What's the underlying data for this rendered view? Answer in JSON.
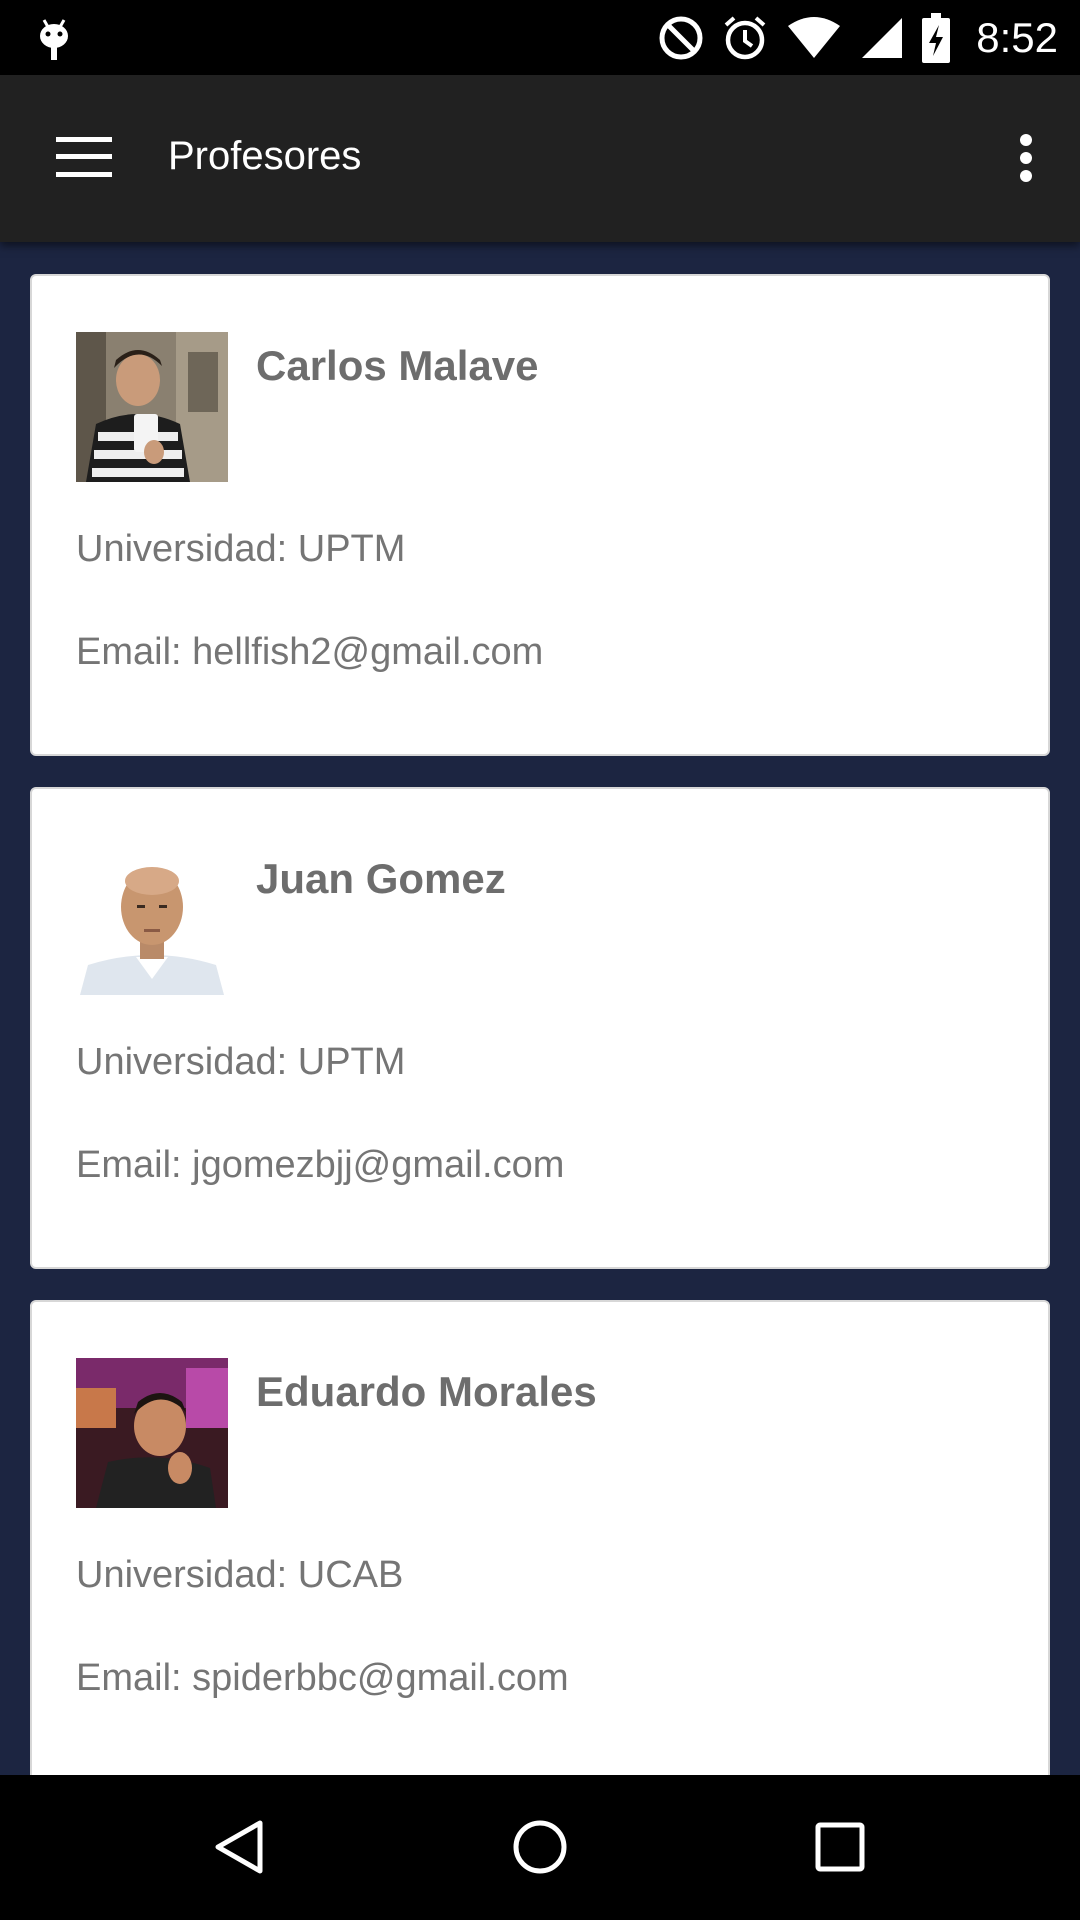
{
  "status_bar": {
    "time": "8:52",
    "icons": [
      "android-debug-icon",
      "do-not-disturb-icon",
      "alarm-icon",
      "wifi-icon",
      "cell-signal-icon",
      "battery-charging-icon"
    ]
  },
  "app_bar": {
    "title": "Profesores",
    "menu_icon": "hamburger-menu-icon",
    "overflow_icon": "more-vert-icon",
    "background": "#212121"
  },
  "colors": {
    "list_background": "#1c2541",
    "card_background": "#ffffff",
    "name_text": "#6d6d6d",
    "detail_text": "#757575"
  },
  "professors": [
    {
      "name": "Carlos Malave",
      "university_label": "Universidad: UPTM",
      "email_label": "Email: hellfish2@gmail.com"
    },
    {
      "name": "Juan Gomez",
      "university_label": "Universidad: UPTM",
      "email_label": "Email: jgomezbjj@gmail.com"
    },
    {
      "name": "Eduardo Morales",
      "university_label": "Universidad: UCAB",
      "email_label": "Email: spiderbbc@gmail.com"
    }
  ],
  "nav_bar": {
    "buttons": [
      "back-icon",
      "home-icon",
      "recents-icon"
    ]
  }
}
